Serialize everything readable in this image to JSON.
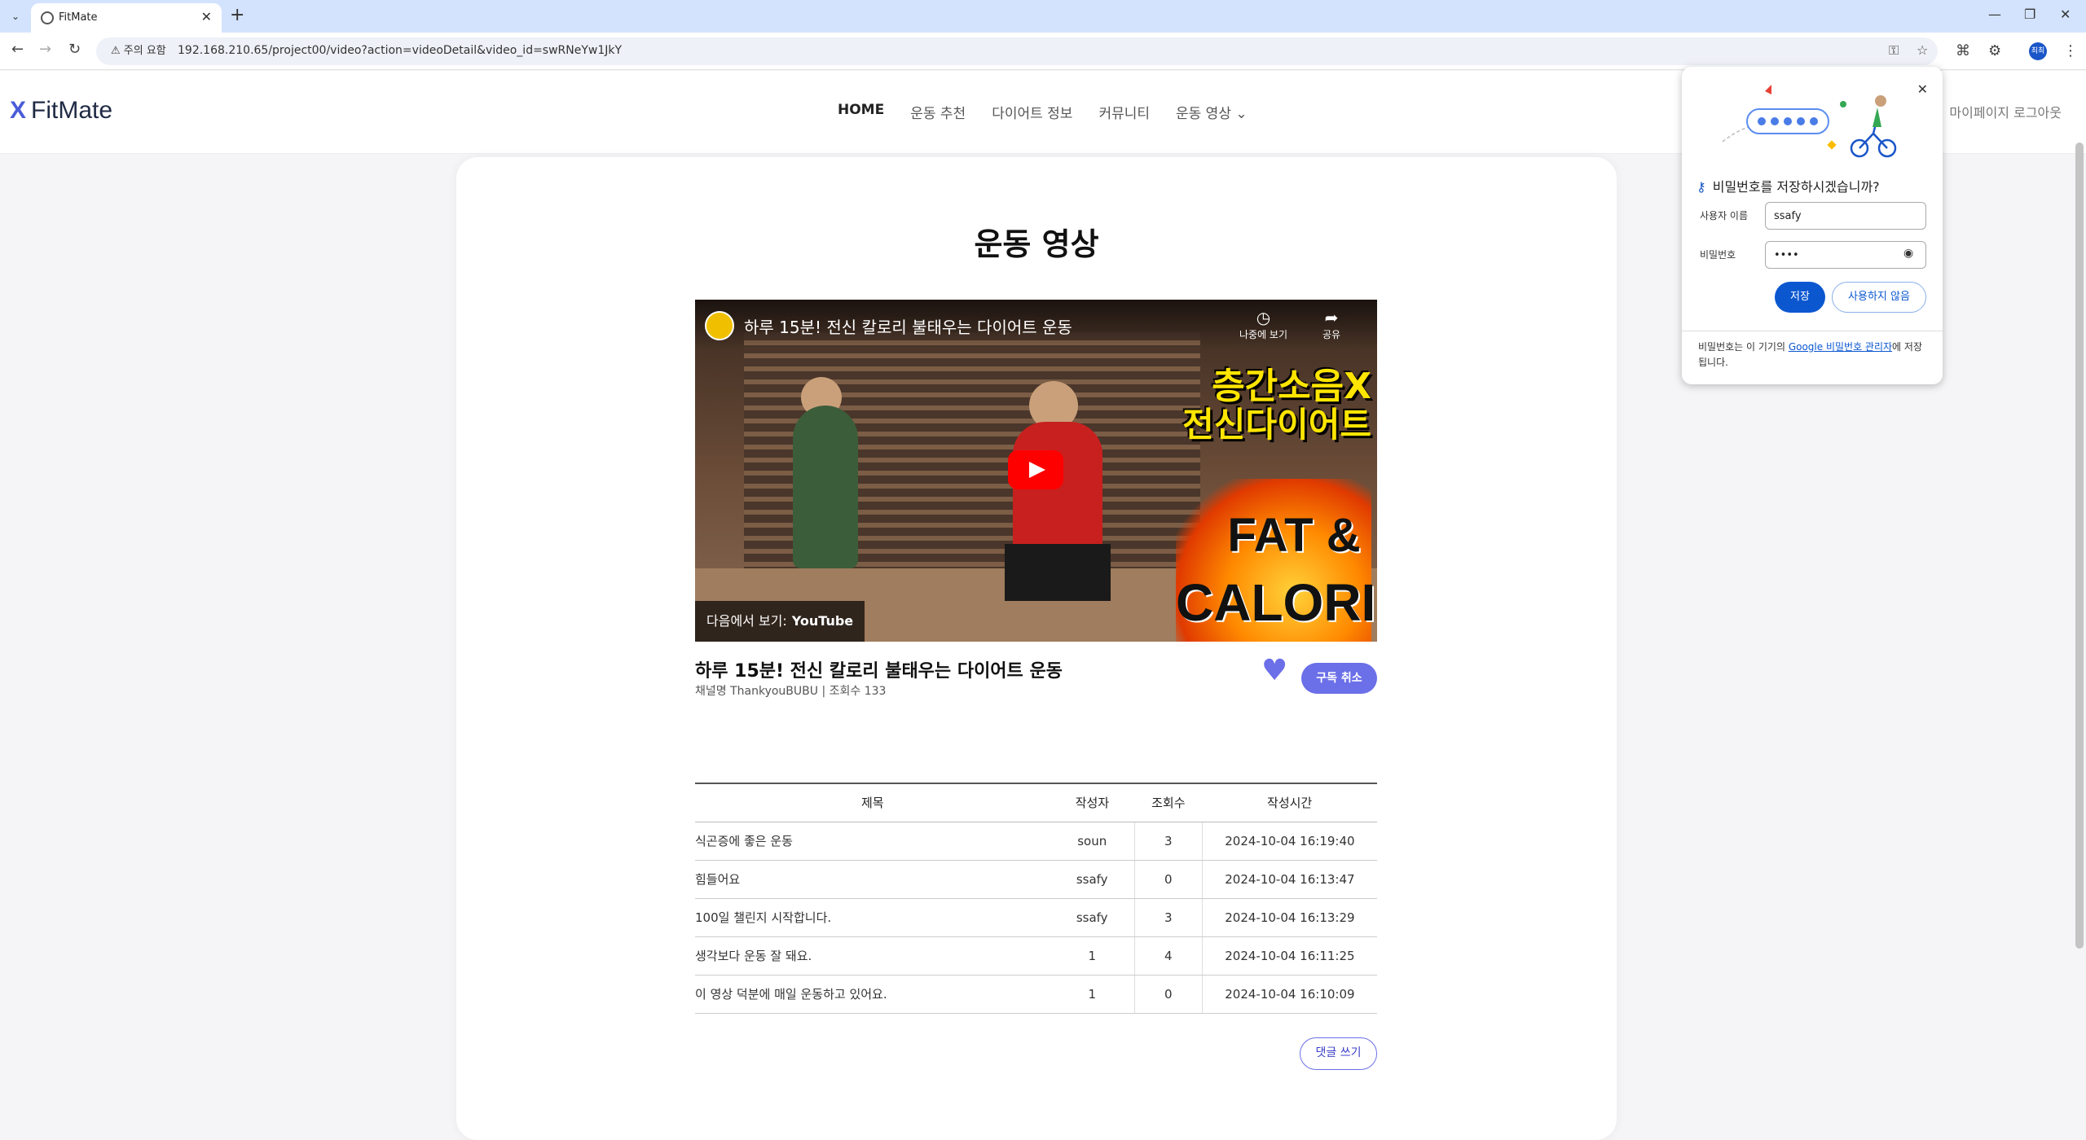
{
  "browser": {
    "tab_title": "FitMate",
    "security_label": "주의 요함",
    "url": "192.168.210.65/project00/video?action=videoDetail&video_id=swRNeYw1JkY",
    "profile_initials": "최최"
  },
  "header": {
    "logo_mark": "X",
    "logo_text": "FitMate",
    "nav": [
      "HOME",
      "운동 추천",
      "다이어트 정보",
      "커뮤니티",
      "운동 영상"
    ],
    "right_links": "마이페이지  로그아웃"
  },
  "page": {
    "title": "운동 영상",
    "video": {
      "embed_title": "하루 15분! 전신 칼로리 불태우는 다이어트 운동",
      "overlay_text_1": "층간소음X",
      "overlay_text_2": "전신다이어트",
      "overlay_fat": "FAT &",
      "overlay_calorie": "CALORIE",
      "watch_later": "나중에 보기",
      "share": "공유",
      "watch_on_label": "다음에서 보기:",
      "watch_on_brand": "YouTube"
    },
    "video_title": "하루 15분! 전신 칼로리 불태우는 다이어트 운동",
    "video_meta": "채널명 ThankyouBUBU | 조회수 133",
    "unsubscribe_label": "구독 취소",
    "table": {
      "headers": [
        "제목",
        "작성자",
        "조회수",
        "작성시간"
      ],
      "rows": [
        [
          "식곤증에 좋은 운동",
          "soun",
          "3",
          "2024-10-04 16:19:40"
        ],
        [
          "힘들어요",
          "ssafy",
          "0",
          "2024-10-04 16:13:47"
        ],
        [
          "100일 챌린지 시작합니다.",
          "ssafy",
          "3",
          "2024-10-04 16:13:29"
        ],
        [
          "생각보다 운동 잘 돼요.",
          "1",
          "4",
          "2024-10-04 16:11:25"
        ],
        [
          "이 영상 덕분에 매일 운동하고 있어요.",
          "1",
          "0",
          "2024-10-04 16:10:09"
        ]
      ]
    },
    "comment_button": "댓글 쓰기"
  },
  "password_popup": {
    "heading": "비밀번호를 저장하시겠습니까?",
    "username_label": "사용자 이름",
    "username_value": "ssafy",
    "password_label": "비밀번호",
    "password_value": "••••",
    "save_label": "저장",
    "never_label": "사용하지 않음",
    "footer_prefix": "비밀번호는 이 기기의 ",
    "footer_link": "Google 비밀번호 관리자",
    "footer_suffix": "에 저장됩니다."
  },
  "colors": {
    "accent": "#6b6fe8",
    "chrome_tabstrip": "#d3e3fd",
    "google_blue": "#0b57d0"
  }
}
